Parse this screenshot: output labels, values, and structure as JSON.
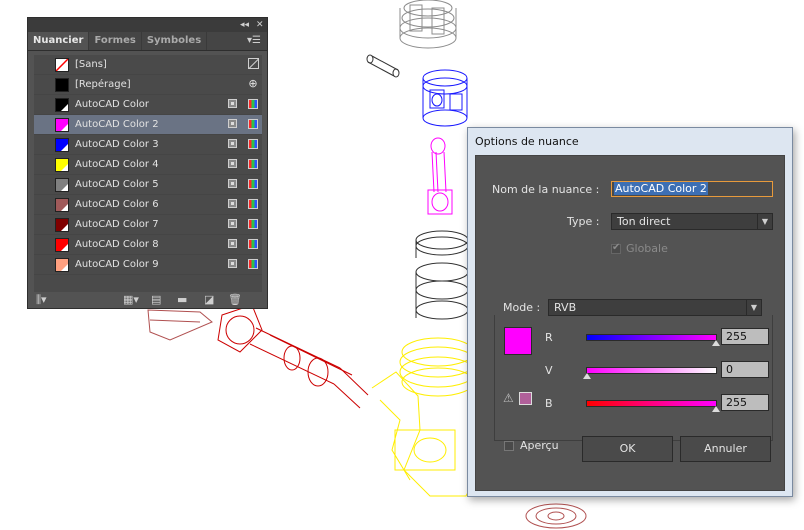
{
  "swatches_panel": {
    "tabs": [
      "Nuancier",
      "Formes",
      "Symboles"
    ],
    "collapse_icon": "double-chevron-left-icon",
    "close_icon": "close-icon",
    "menu_icon": "panel-menu-icon",
    "items": [
      {
        "label": "[Sans]",
        "color": "#ffffff",
        "type": "none"
      },
      {
        "label": "[Repérage]",
        "color": "#000000",
        "type": "registration"
      },
      {
        "label": "AutoCAD Color",
        "color": "#000000",
        "type": "spot"
      },
      {
        "label": "AutoCAD Color 2",
        "color": "#ff00ff",
        "type": "spot",
        "selected": true
      },
      {
        "label": "AutoCAD Color 3",
        "color": "#0000ff",
        "type": "spot"
      },
      {
        "label": "AutoCAD Color 4",
        "color": "#ffff00",
        "type": "spot"
      },
      {
        "label": "AutoCAD Color 5",
        "color": "#808080",
        "type": "spot"
      },
      {
        "label": "AutoCAD Color 6",
        "color": "#a05a5a",
        "type": "spot"
      },
      {
        "label": "AutoCAD Color 7",
        "color": "#800000",
        "type": "spot"
      },
      {
        "label": "AutoCAD Color 8",
        "color": "#ff0000",
        "type": "spot"
      },
      {
        "label": "AutoCAD Color 9",
        "color": "#ffa080",
        "type": "spot"
      }
    ],
    "bottom_icons": [
      "library-icon",
      "show-kinds-icon",
      "swatch-options-icon",
      "new-group-icon",
      "new-swatch-icon",
      "delete-icon"
    ]
  },
  "dialog": {
    "title": "Options de nuance",
    "name_label": "Nom de la nuance :",
    "name_value": "AutoCAD Color 2",
    "type_label": "Type :",
    "type_value": "Ton direct",
    "global_label": "Globale",
    "mode_label": "Mode :",
    "mode_value": "RVB",
    "preview_color": "#ff00ff",
    "sliders": [
      {
        "label": "R",
        "value": "255",
        "fraction": 1.0
      },
      {
        "label": "V",
        "value": "0",
        "fraction": 0.0
      },
      {
        "label": "B",
        "value": "255",
        "fraction": 1.0
      }
    ],
    "warning_icon": "out-of-gamut-warning-icon",
    "preview_label": "Aperçu",
    "ok_label": "OK",
    "cancel_label": "Annuler"
  },
  "colors": {
    "drawing_gray": "#8c8c8c",
    "drawing_blue": "#1a1aff",
    "drawing_magenta": "#ff00ff",
    "drawing_red": "#cc0000",
    "drawing_yellow": "#ffee00",
    "drawing_brown": "#b05050"
  }
}
